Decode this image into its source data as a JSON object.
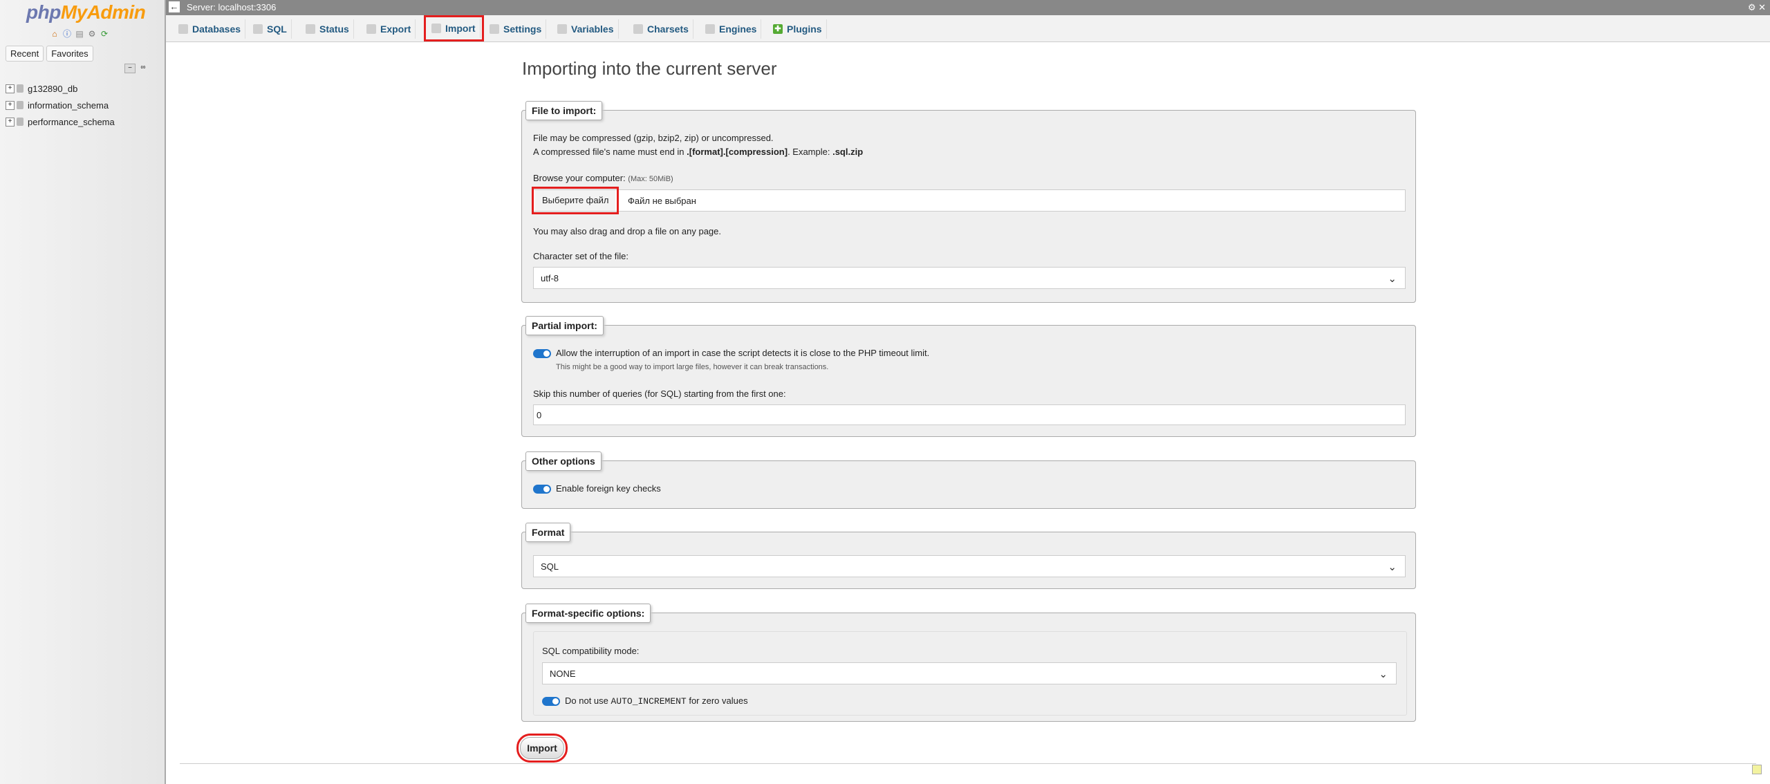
{
  "sidebar": {
    "logo_php": "php",
    "logo_ma": "MyAdmin",
    "icons": [
      "home-icon",
      "info-icon",
      "docs-icon",
      "settings-icon",
      "reload-icon"
    ],
    "tabs": [
      "Recent",
      "Favorites"
    ],
    "databases": [
      "g132890_db",
      "information_schema",
      "performance_schema"
    ]
  },
  "topbar": {
    "server_label": "Server: localhost:3306"
  },
  "tabs": [
    "Databases",
    "SQL",
    "Status",
    "Export",
    "Import",
    "Settings",
    "Variables",
    "Charsets",
    "Engines",
    "Plugins"
  ],
  "page_title": "Importing into the current server",
  "file_to_import": {
    "legend": "File to import:",
    "line1": "File may be compressed (gzip, bzip2, zip) or uncompressed.",
    "line2_a": "A compressed file's name must end in ",
    "line2_b": ".[format].[compression]",
    "line2_c": ". Example: ",
    "line2_d": ".sql.zip",
    "browse_label": "Browse your computer:",
    "max_label": "(Max: 50MiB)",
    "choose_button": "Выберите файл",
    "no_file": "Файл не выбран",
    "drag_note": "You may also drag and drop a file on any page.",
    "charset_label": "Character set of the file:",
    "charset_value": "utf-8"
  },
  "partial_import": {
    "legend": "Partial import:",
    "allow_interrupt": "Allow the interruption of an import in case the script detects it is close to the PHP timeout limit.",
    "allow_note": "This might be a good way to import large files, however it can break transactions.",
    "skip_label": "Skip this number of queries (for SQL) starting from the first one:",
    "skip_value": "0"
  },
  "other_options": {
    "legend": "Other options",
    "foreign_keys": "Enable foreign key checks"
  },
  "format": {
    "legend": "Format",
    "value": "SQL"
  },
  "format_specific": {
    "legend": "Format-specific options:",
    "compat_label": "SQL compatibility mode:",
    "compat_value": "NONE",
    "auto_inc_a": "Do not use ",
    "auto_inc_code": "AUTO_INCREMENT",
    "auto_inc_b": " for zero values"
  },
  "import_button": "Import",
  "colors": {
    "accent": "#1f75cc",
    "highlight": "#e41e1e",
    "tab_text": "#235a81"
  }
}
